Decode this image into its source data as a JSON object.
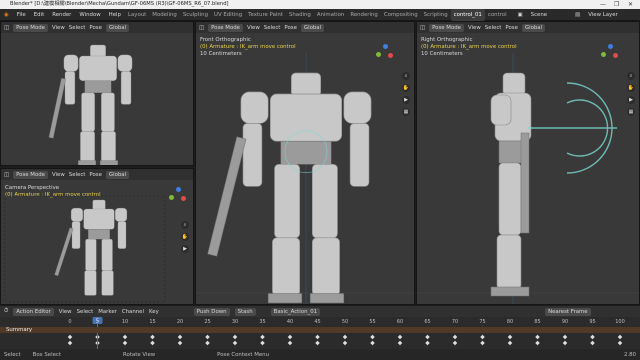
{
  "window": {
    "title": "Blender* [D:\\建模相關\\Blender\\Mecha\\Gundam\\GF-06MS (R3)\\GF-06MS_R6_07.blend]",
    "controls": [
      "—",
      "❐",
      "✕"
    ]
  },
  "menu": [
    "File",
    "Edit",
    "Render",
    "Window",
    "Help"
  ],
  "workspaces": [
    "Layout",
    "Modeling",
    "Sculpting",
    "UV Editing",
    "Texture Paint",
    "Shading",
    "Animation",
    "Rendering",
    "Compositing",
    "Scripting",
    "control_01",
    "control"
  ],
  "active_workspace": "control_01",
  "scene": {
    "label": "Scene",
    "view_layer": "View Layer"
  },
  "viewports": {
    "top_left": {
      "mode": "Pose Mode",
      "menus": [
        "View",
        "Select",
        "Pose"
      ],
      "orientation": "Global"
    },
    "bottom_left": {
      "mode": "Pose Mode",
      "menus": [
        "View",
        "Select",
        "Pose"
      ],
      "orientation": "Global",
      "view_name": "Camera Perspective",
      "armature": "(0) Armature : IK_arm move control"
    },
    "center": {
      "mode": "Pose Mode",
      "menus": [
        "View",
        "Select",
        "Pose"
      ],
      "orientation": "Global",
      "view_name": "Front Orthographic",
      "armature": "(0) Armature : IK_arm move control",
      "units": "10 Centimeters"
    },
    "right": {
      "mode": "Pose Mode",
      "menus": [
        "View",
        "Select",
        "Pose"
      ],
      "orientation": "Global",
      "view_name": "Right Orthographic",
      "armature": "(0) Armature : IK_arm move control",
      "units": "10 Centimeters"
    }
  },
  "timeline": {
    "editor": "Action Editor",
    "menus": [
      "View",
      "Select",
      "Marker",
      "Channel",
      "Key"
    ],
    "push_down": "Push Down",
    "stash": "Stash",
    "action": "Basic_Action_01",
    "interpolation": "Nearest Frame",
    "summary": "Summary",
    "current_frame": 5,
    "ticks": [
      0,
      5,
      10,
      15,
      20,
      25,
      30,
      35,
      40,
      45,
      50,
      55,
      60,
      65,
      70,
      75,
      80,
      85,
      90,
      95,
      100
    ],
    "keyframes": [
      0,
      5,
      10,
      15,
      20,
      25,
      30,
      35,
      40,
      45,
      50,
      55,
      60,
      65,
      70,
      75,
      80,
      85,
      90,
      95,
      100
    ]
  },
  "status": [
    "Select",
    "Box Select",
    "Rotate View",
    "Pose Context Menu"
  ],
  "version": "2.80",
  "colors": {
    "accent_yellow": "#e8d24a",
    "axis_x": "#e24a4a",
    "axis_y": "#7dbb3a",
    "axis_z": "#3f7fe0",
    "summary_bg": "#4e3a26",
    "playhead": "#4772b3"
  }
}
